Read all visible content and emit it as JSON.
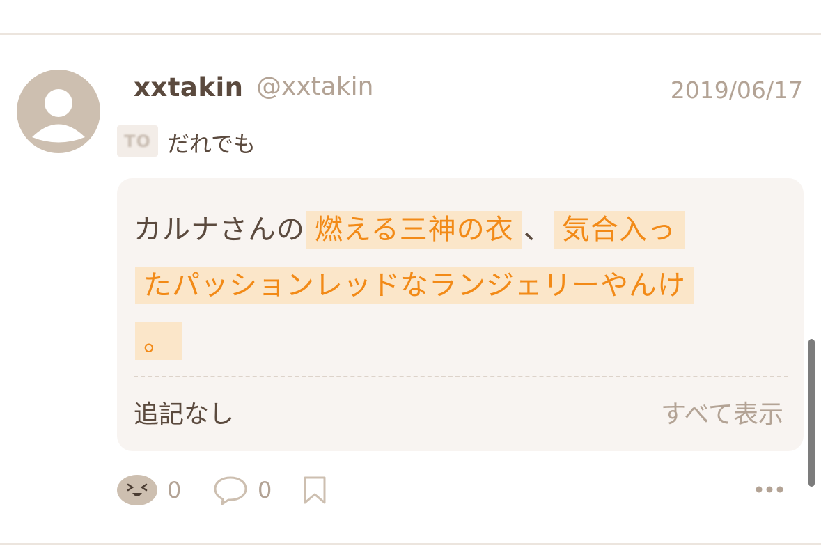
{
  "post": {
    "author_name": "xxtakin",
    "author_handle": "@xxtakin",
    "date": "2019/06/17",
    "to_badge": "TO",
    "to_target": "だれでも",
    "body": {
      "seg1": "カルナさんの",
      "hl1": "燃える三神の衣",
      "seg2": "、",
      "hl2": "気合入っ",
      "hl3": "たパッションレッドなランジェリーやんけ",
      "hl4": "。"
    },
    "addendum_status": "追記なし",
    "show_all_label": "すべて表示"
  },
  "actions": {
    "reaction_count": "0",
    "comment_count": "0"
  },
  "colors": {
    "accent": "#f28a17",
    "highlight_bg": "#fbe6c9",
    "text": "#5b4a3e",
    "muted": "#b3a395",
    "card_bg": "#f8f4f1",
    "avatar": "#cdbfb0"
  },
  "icons": {
    "avatar": "default-user-icon",
    "reaction": "laughing-face-icon",
    "comment": "speech-bubble-icon",
    "bookmark": "bookmark-icon",
    "more": "more-dots-icon"
  }
}
